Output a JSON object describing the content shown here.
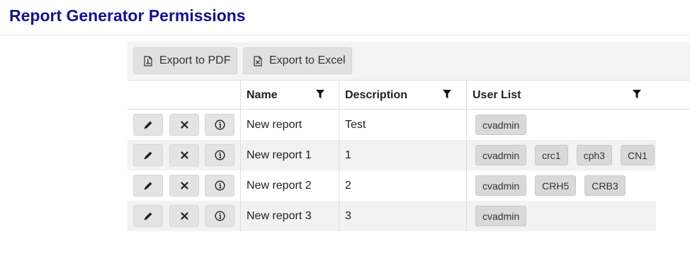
{
  "page": {
    "title": "Report Generator Permissions"
  },
  "toolbar": {
    "export_pdf_label": "Export to PDF",
    "export_excel_label": "Export to Excel"
  },
  "grid": {
    "columns": {
      "name": "Name",
      "description": "Description",
      "user_list": "User List"
    },
    "rows": [
      {
        "name": "New report",
        "description": "Test",
        "users": [
          "cvadmin"
        ]
      },
      {
        "name": "New report 1",
        "description": "1",
        "users": [
          "cvadmin",
          "crc1",
          "cph3",
          "CN1"
        ]
      },
      {
        "name": "New report 2",
        "description": "2",
        "users": [
          "cvadmin",
          "CRH5",
          "CRB3"
        ]
      },
      {
        "name": "New report 3",
        "description": "3",
        "users": [
          "cvadmin"
        ]
      }
    ]
  },
  "icons": {
    "export_pdf": "pdf-file-icon",
    "export_excel": "excel-file-icon",
    "filter": "filter-icon",
    "edit": "pencil-icon",
    "delete": "close-icon",
    "info": "info-icon"
  },
  "colors": {
    "title": "#12128f",
    "toolbar_bg": "#f4f4f4",
    "button_bg": "#e1e1e1",
    "alt_row": "#f2f2f2",
    "tag_bg": "#d9d9d9"
  }
}
